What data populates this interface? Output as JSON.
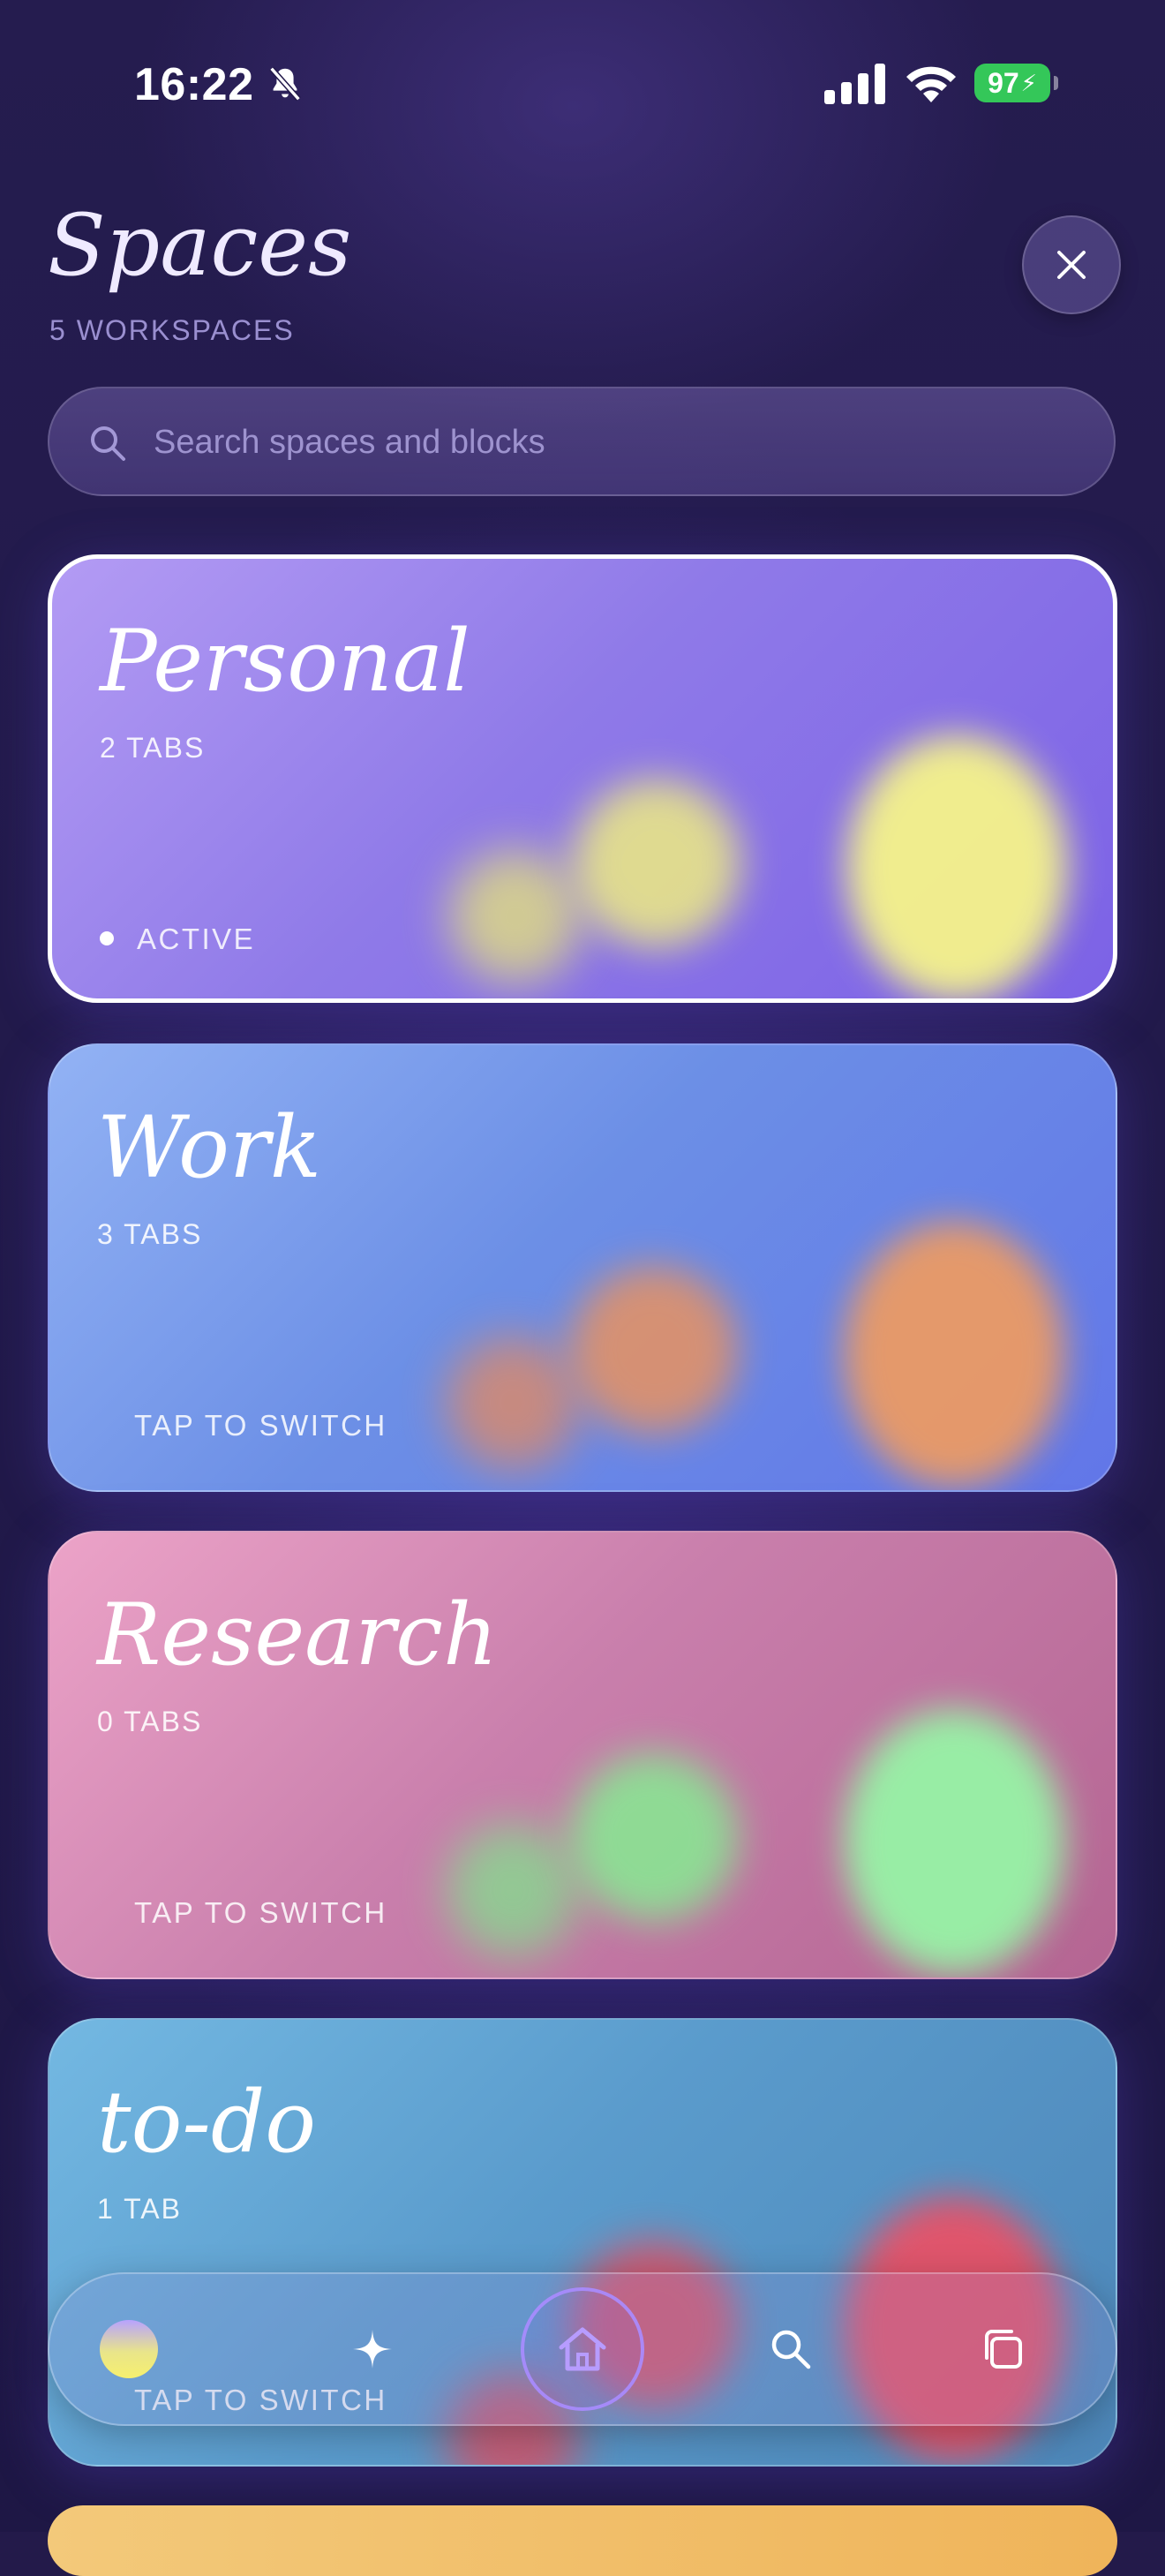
{
  "status_bar": {
    "time": "16:22",
    "battery": "97",
    "icons": [
      "bell-slash-icon",
      "cellular-signal-icon",
      "wifi-icon",
      "battery-charging-icon"
    ]
  },
  "header": {
    "title": "Spaces",
    "subtitle": "5 WORKSPACES",
    "close_icon": "close-icon"
  },
  "search": {
    "placeholder": "Search spaces and blocks",
    "value": "",
    "icon": "search-icon"
  },
  "spaces": [
    {
      "name": "Personal",
      "tabs": "2 TABS",
      "status": "ACTIVE",
      "active": true,
      "color": "#9b7ff0",
      "blob_color": "#f4f28a"
    },
    {
      "name": "Work",
      "tabs": "3 TABS",
      "status": "TAP TO SWITCH",
      "active": false,
      "color": "#6f8ff0",
      "blob_color": "#f09a5a"
    },
    {
      "name": "Research",
      "tabs": "0 TABS",
      "status": "TAP TO SWITCH",
      "active": false,
      "color": "#d98ab8",
      "blob_color": "#8ef3a0"
    },
    {
      "name": "to-do",
      "tabs": "1 TAB",
      "status": "TAP TO SWITCH",
      "active": false,
      "color": "#5fa6d8",
      "blob_color": "#f04d60"
    }
  ],
  "bottom_nav": {
    "items": [
      "space-avatar",
      "sparkle-icon",
      "home-icon",
      "search-icon",
      "tabs-icon"
    ]
  }
}
